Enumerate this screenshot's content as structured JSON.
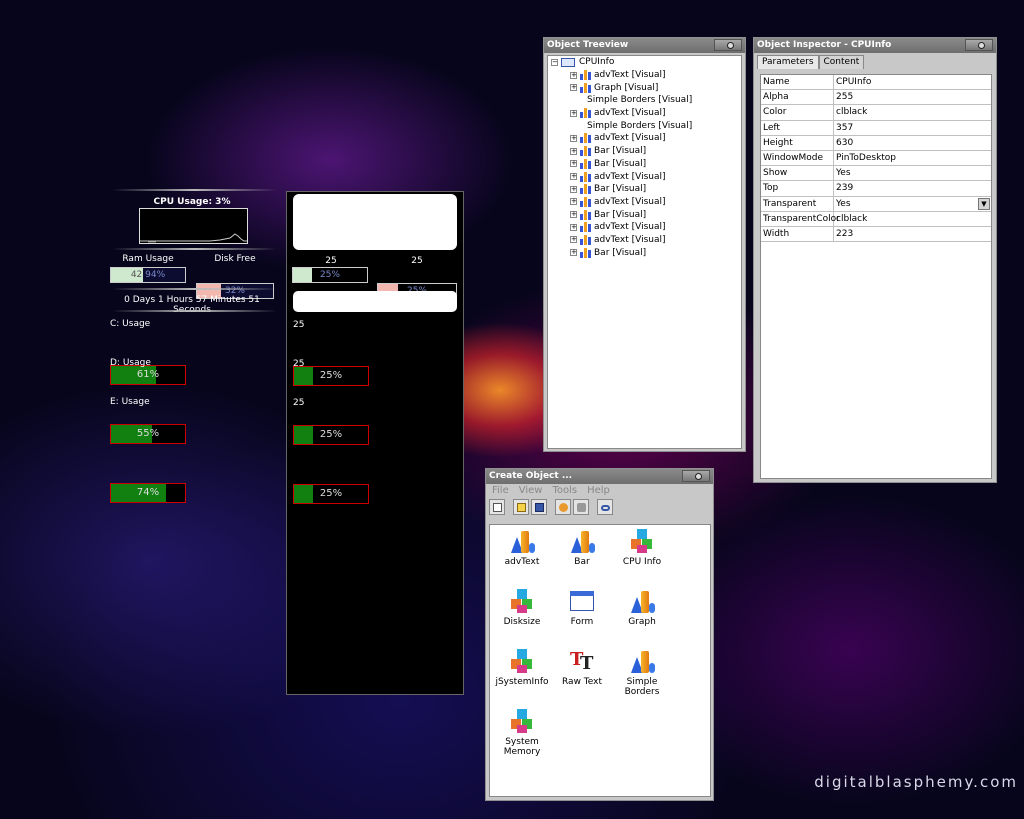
{
  "watermark": "digitalblasphemy.com",
  "cpu_widget": {
    "cpu_title": "CPU Usage: 3%",
    "ram_label": "Ram Usage",
    "disk_label": "Disk Free",
    "ram_bar_text": "42",
    "ram_bar_value": "94%",
    "disk_bar_value": "32%",
    "uptime": "0 Days 1 Hours 57 Minutes 51 Seconds",
    "drives": [
      {
        "label": "C: Usage",
        "value": "61%",
        "fraction": 0.61
      },
      {
        "label": "D: Usage",
        "value": "55%",
        "fraction": 0.55
      },
      {
        "label": "E: Usage",
        "value": "74%",
        "fraction": 0.74
      }
    ],
    "colors": {
      "drive_fill": "#118011",
      "drive_border": "#cc0000",
      "ram_fill": "#cfe9cf",
      "disk_fill": "#f2b8b0"
    }
  },
  "preview_panel": {
    "num_left": "25",
    "num_right": "25",
    "bar_left": "25%",
    "bar_right": "25%",
    "drives": [
      {
        "label": "25",
        "value": "25%",
        "fraction": 0.25
      },
      {
        "label": "25",
        "value": "25%",
        "fraction": 0.25
      },
      {
        "label": "25",
        "value": "25%",
        "fraction": 0.25
      }
    ]
  },
  "treeview": {
    "title": "Object Treeview",
    "root": "CPUInfo",
    "items": [
      {
        "label": "advText [Visual]",
        "expandable": true
      },
      {
        "label": "Graph [Visual]",
        "expandable": true
      },
      {
        "label": "Simple Borders [Visual]",
        "expandable": false
      },
      {
        "label": "advText [Visual]",
        "expandable": true
      },
      {
        "label": "Simple Borders [Visual]",
        "expandable": false
      },
      {
        "label": "advText [Visual]",
        "expandable": true
      },
      {
        "label": "Bar [Visual]",
        "expandable": true
      },
      {
        "label": "Bar [Visual]",
        "expandable": true
      },
      {
        "label": "advText [Visual]",
        "expandable": true
      },
      {
        "label": "Bar [Visual]",
        "expandable": true
      },
      {
        "label": "advText [Visual]",
        "expandable": true
      },
      {
        "label": "Bar [Visual]",
        "expandable": true
      },
      {
        "label": "advText [Visual]",
        "expandable": true
      },
      {
        "label": "advText [Visual]",
        "expandable": true
      },
      {
        "label": "Bar [Visual]",
        "expandable": true
      }
    ]
  },
  "inspector": {
    "title": "Object Inspector - CPUInfo",
    "tabs": [
      "Parameters",
      "Content"
    ],
    "rows": [
      {
        "key": "Name",
        "value": "CPUInfo"
      },
      {
        "key": "Alpha",
        "value": "255"
      },
      {
        "key": "Color",
        "value": "clblack"
      },
      {
        "key": "Left",
        "value": "357"
      },
      {
        "key": "Height",
        "value": "630"
      },
      {
        "key": "WindowMode",
        "value": "PinToDesktop"
      },
      {
        "key": "Show",
        "value": "Yes"
      },
      {
        "key": "Top",
        "value": "239"
      },
      {
        "key": "Transparent",
        "value": "Yes"
      },
      {
        "key": "TransparentColor",
        "value": "clblack"
      },
      {
        "key": "Width",
        "value": "223"
      }
    ]
  },
  "create_object": {
    "title": "Create Object ...",
    "menu": [
      "File",
      "View",
      "Tools",
      "Help"
    ],
    "toolbar_icons": [
      "new-icon",
      "open-icon",
      "save-icon",
      "tools-icon",
      "settings-icon",
      "link-icon"
    ],
    "objects": [
      {
        "label": "advText",
        "icon": "advtext-icon"
      },
      {
        "label": "Bar",
        "icon": "bar-icon"
      },
      {
        "label": "CPU Info",
        "icon": "cpuinfo-icon"
      },
      {
        "label": "Disksize",
        "icon": "disksize-icon"
      },
      {
        "label": "Form",
        "icon": "form-icon"
      },
      {
        "label": "Graph",
        "icon": "graph-icon"
      },
      {
        "label": "jSystemInfo",
        "icon": "jsysteminfo-icon"
      },
      {
        "label": "Raw Text",
        "icon": "rawtext-icon"
      },
      {
        "label": "Simple Borders",
        "icon": "simpleborders-icon"
      },
      {
        "label": "System Memory",
        "icon": "systemmemory-icon"
      }
    ]
  }
}
